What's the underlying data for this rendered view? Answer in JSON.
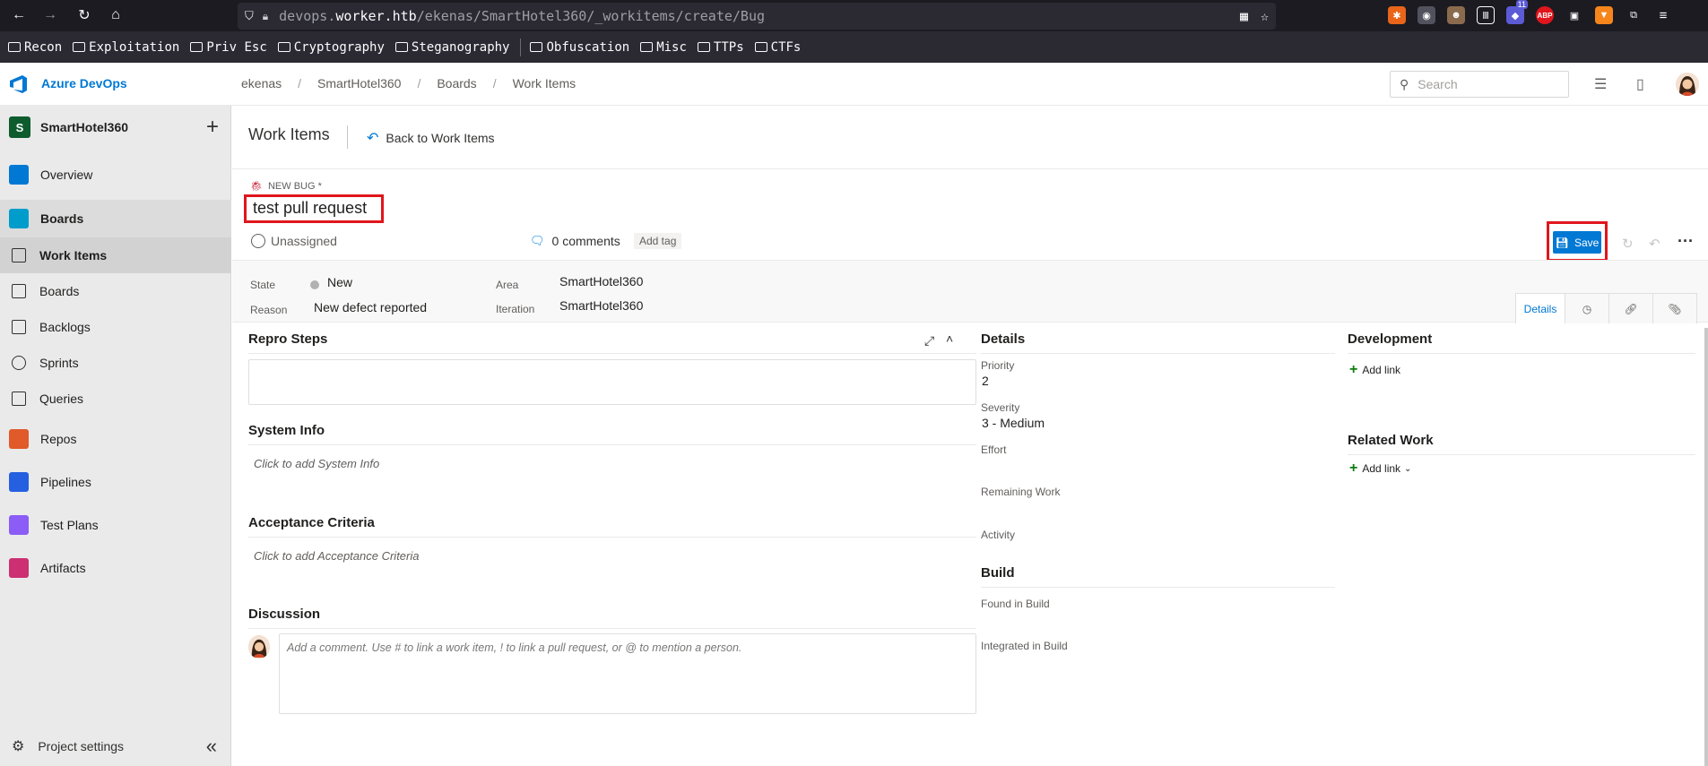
{
  "browser": {
    "url_prefix": "devops.",
    "url_domain": "worker.htb",
    "url_path": "/ekenas/SmartHotel360/_workitems/create/Bug",
    "ext_badge_count": "11",
    "abp_label": "ABP"
  },
  "bookmarks": [
    "Recon",
    "Exploitation",
    "Priv Esc",
    "Cryptography",
    "Steganography",
    "Obfuscation",
    "Misc",
    "TTPs",
    "CTFs"
  ],
  "header": {
    "app_title": "Azure DevOps",
    "breadcrumbs": [
      "ekenas",
      "SmartHotel360",
      "Boards",
      "Work Items"
    ],
    "search_placeholder": "Search"
  },
  "sidebar": {
    "project_initial": "S",
    "project_name": "SmartHotel360",
    "items": [
      {
        "label": "Overview",
        "color": "#0078d4"
      },
      {
        "label": "Boards",
        "color": "#009ccc"
      },
      {
        "label": "Work Items"
      },
      {
        "label": "Boards"
      },
      {
        "label": "Backlogs"
      },
      {
        "label": "Sprints"
      },
      {
        "label": "Queries"
      },
      {
        "label": "Repos",
        "color": "#e05a2a"
      },
      {
        "label": "Pipelines",
        "color": "#2560e0"
      },
      {
        "label": "Test Plans",
        "color": "#8b5cf6"
      },
      {
        "label": "Artifacts",
        "color": "#cc2f72"
      }
    ],
    "settings_label": "Project settings"
  },
  "page": {
    "title": "Work Items",
    "back_link": "Back to Work Items"
  },
  "work_item": {
    "type_label": "NEW BUG *",
    "title": "test pull request",
    "assignee": "Unassigned",
    "comments": "0 comments",
    "add_tag": "Add tag",
    "save_label": "Save",
    "fields": {
      "state_label": "State",
      "state_value": "New",
      "reason_label": "Reason",
      "reason_value": "New defect reported",
      "area_label": "Area",
      "area_value": "SmartHotel360",
      "iteration_label": "Iteration",
      "iteration_value": "SmartHotel360"
    },
    "tabs": {
      "details": "Details"
    }
  },
  "sections": {
    "repro_steps": "Repro Steps",
    "system_info": "System Info",
    "system_info_placeholder": "Click to add System Info",
    "acceptance": "Acceptance Criteria",
    "acceptance_placeholder": "Click to add Acceptance Criteria",
    "discussion": "Discussion",
    "discussion_placeholder": "Add a comment. Use # to link a work item, ! to link a pull request, or @ to mention a person."
  },
  "details": {
    "title": "Details",
    "priority_label": "Priority",
    "priority_value": "2",
    "severity_label": "Severity",
    "severity_value": "3 - Medium",
    "effort_label": "Effort",
    "remaining_label": "Remaining Work",
    "activity_label": "Activity"
  },
  "build": {
    "title": "Build",
    "found_label": "Found in Build",
    "integrated_label": "Integrated in Build"
  },
  "development": {
    "title": "Development",
    "add_link": "Add link",
    "related_title": "Related Work",
    "related_add_link": "Add link"
  },
  "colors": {
    "accent": "#0078d4",
    "bug_red": "#cc293d",
    "highlight_red": "#e0161c"
  }
}
